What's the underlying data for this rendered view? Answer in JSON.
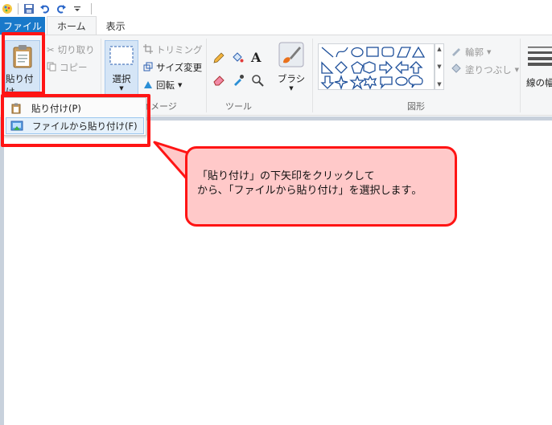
{
  "tabs": {
    "file": "ファイル",
    "home": "ホーム",
    "view": "表示"
  },
  "clipboard": {
    "paste_label": "貼り付け",
    "cut_label": "切り取り",
    "copy_label": "コピー"
  },
  "image": {
    "select_label": "選択",
    "trim_label": "トリミング",
    "resize_label": "サイズ変更",
    "rotate_label": "回転",
    "group_label": "イメージ"
  },
  "tools": {
    "group_label": "ツール",
    "brush_label": "ブラシ"
  },
  "shapes": {
    "group_label": "図形",
    "outline_label": "輪郭",
    "fill_label": "塗りつぶし"
  },
  "size": {
    "label": "線の幅"
  },
  "dropdown": {
    "item1": "貼り付け(P)",
    "item2": "ファイルから貼り付け(F)"
  },
  "callout": {
    "line1": "「貼り付け」の下矢印をクリックして",
    "line2": "から､「ファイルから貼り付け」を選択します｡"
  },
  "colors": {
    "highlight": "#ff1414",
    "callout_bg": "#ffc9c9",
    "file_tab": "#1979ca"
  }
}
